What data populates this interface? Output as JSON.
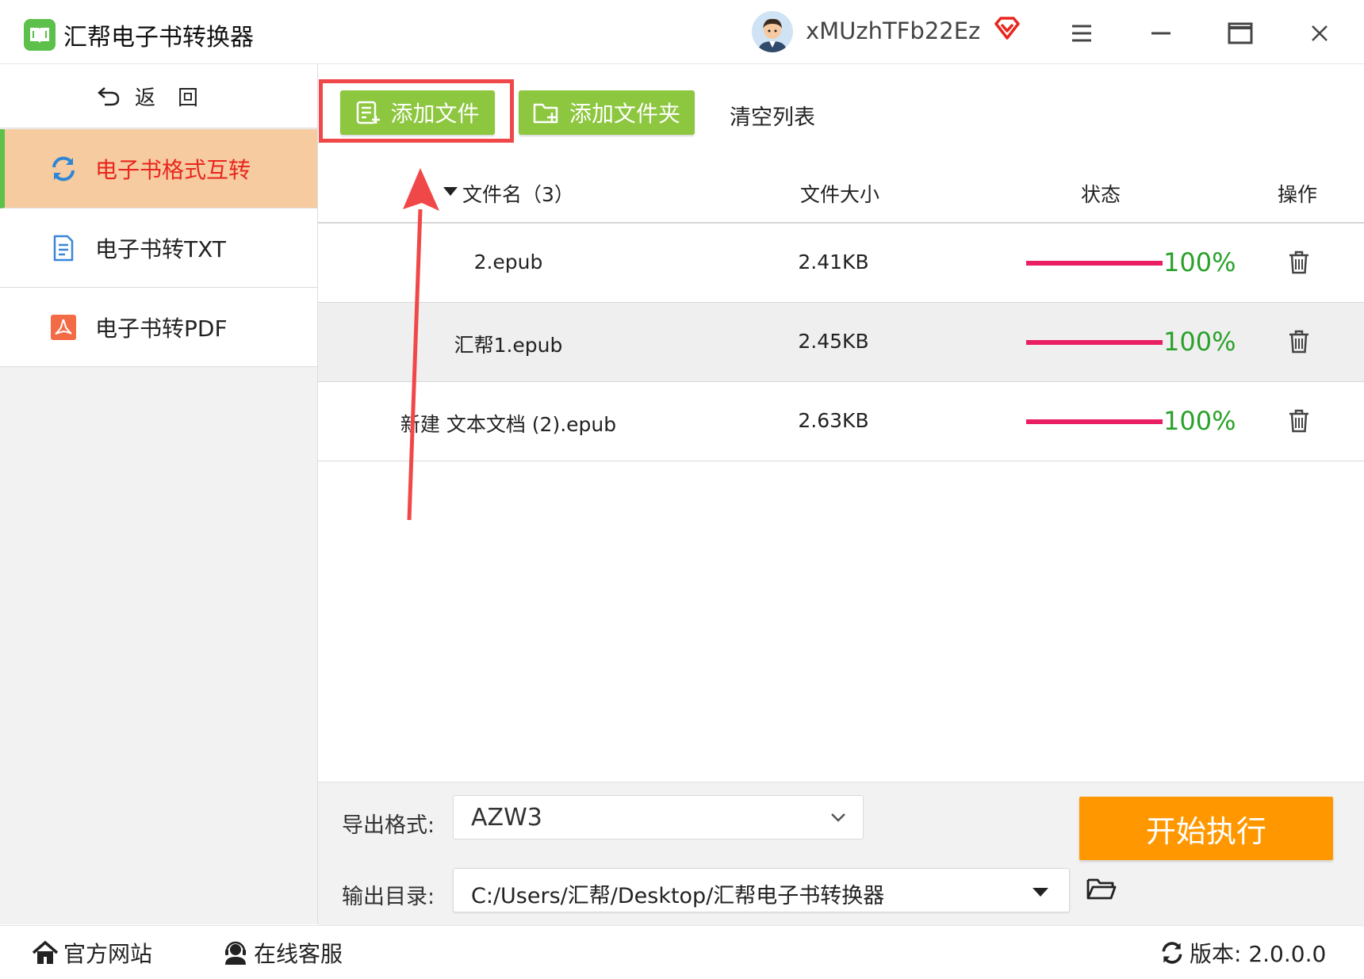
{
  "app": {
    "title": "汇帮电子书转换器",
    "username": "xMUzhTFb22Ez"
  },
  "sidebar": {
    "back_label": "返回",
    "items": [
      {
        "label": "电子书格式互转",
        "active": true
      },
      {
        "label": "电子书转TXT",
        "active": false
      },
      {
        "label": "电子书转PDF",
        "active": false
      }
    ]
  },
  "toolbar": {
    "add_file_label": "添加文件",
    "add_folder_label": "添加文件夹",
    "clear_list_label": "清空列表"
  },
  "table": {
    "columns": [
      "文件名（3）",
      "文件大小",
      "状态",
      "操作"
    ],
    "header_name": "文件名（3）",
    "rows": [
      {
        "name": "2.epub",
        "size": "2.41KB",
        "progress": 100,
        "progress_label": "100%"
      },
      {
        "name": "汇帮1.epub",
        "size": "2.45KB",
        "progress": 100,
        "progress_label": "100%"
      },
      {
        "name": "新建 文本文档 (2).epub",
        "size": "2.63KB",
        "progress": 100,
        "progress_label": "100%"
      }
    ]
  },
  "settings": {
    "format_label": "导出格式:",
    "format_value": "AZW3",
    "dir_label": "输出目录:",
    "dir_value": "C:/Users/汇帮/Desktop/汇帮电子书转换器",
    "start_label": "开始执行"
  },
  "statusbar": {
    "site_label": "官方网站",
    "support_label": "在线客服",
    "version_label": "版本: 2.0.0.0"
  },
  "colors": {
    "accent_green": "#8dc63f",
    "active_tab_bg": "#f7cba0",
    "active_tab_text": "#e8261e",
    "start_button": "#ff9800",
    "progress_bar": "#e91e63",
    "progress_text": "#2aa12a",
    "annotation_red": "#f04848"
  },
  "icons": {
    "app": "book-icon",
    "vip": "diamond-icon",
    "menu": "hamburger-icon",
    "minimize": "minimize-icon",
    "maximize": "maximize-icon",
    "close": "close-icon",
    "back": "undo-arrow-icon",
    "format_convert": "refresh-icon",
    "to_txt": "document-icon",
    "to_pdf": "pdf-icon",
    "delete": "trash-icon",
    "folder": "folder-open-icon",
    "home": "home-icon",
    "support": "headset-icon",
    "update": "refresh-icon"
  }
}
